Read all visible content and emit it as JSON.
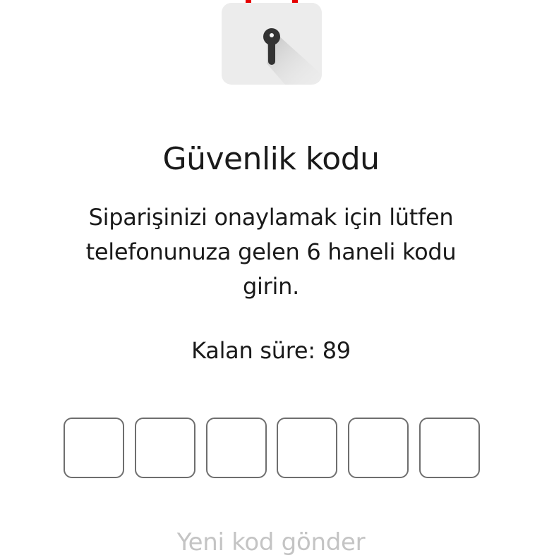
{
  "icon": {
    "name": "lock-calendar-icon",
    "accent_color": "#e60000",
    "tile_color": "#ececec",
    "keyhole_color": "#333333"
  },
  "title": "Güvenlik kodu",
  "description": "Siparişinizi onaylamak için lütfen telefonunuza gelen 6 haneli kodu girin.",
  "timer": {
    "label": "Kalan süre:",
    "value": "89"
  },
  "code_inputs": {
    "count": 6,
    "values": [
      "",
      "",
      "",
      "",
      "",
      ""
    ]
  },
  "resend": {
    "label": "Yeni kod gönder",
    "color": "#c4c4c4"
  }
}
